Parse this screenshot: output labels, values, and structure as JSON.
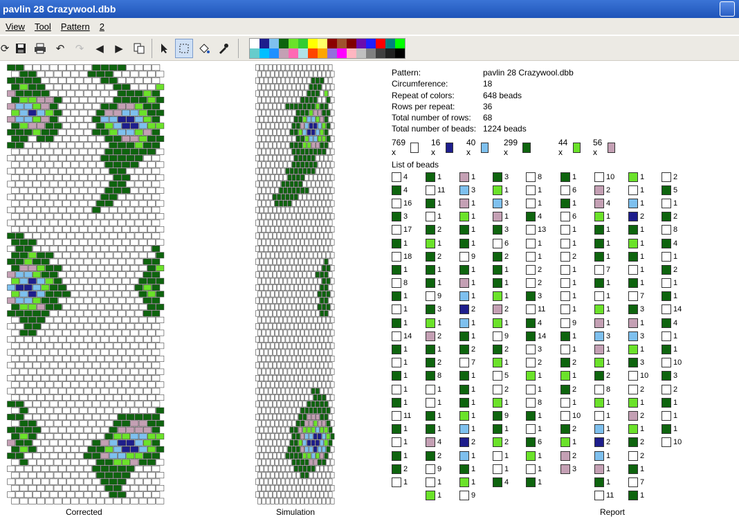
{
  "window": {
    "title": "pavlin 28 Crazywool.dbb"
  },
  "menu": [
    "View",
    "Tool",
    "Pattern",
    "2"
  ],
  "toolbar": [
    "refresh-icon",
    "save-icon",
    "print-icon",
    "undo-icon",
    "redo-icon",
    "arrow-left-icon",
    "arrow-right-icon",
    "copy-icon",
    "pointer-icon",
    "select-rect-icon",
    "fill-icon",
    "eyedropper-icon"
  ],
  "colors": {
    "white": "#ffffff",
    "dark_blue": "#1e1e8c",
    "light_blue": "#7ec0ee",
    "dark_green": "#0e640e",
    "lime": "#6be22a",
    "mauve": "#c4a0b4"
  },
  "palette": [
    "#ffffff",
    "#1e1e8c",
    "#7ec0ee",
    "#0e640e",
    "#6be22a",
    "#32cd32",
    "#ffff00",
    "#ffff66",
    "#8b0000",
    "#a0522d",
    "#800000",
    "#6a0dad",
    "#1e1eff",
    "#ff0000",
    "#008080",
    "#00ff00",
    "#66cccc",
    "#00bfff",
    "#1e90ff",
    "#c4a0b4",
    "#ff69b4",
    "#b0e0e6",
    "#ff4500",
    "#ffa500",
    "#9370db",
    "#ff00ff",
    "#ffb6c1",
    "#c0c0c0",
    "#808080",
    "#404040",
    "#202020",
    "#000000"
  ],
  "captions": {
    "corrected": "Corrected",
    "simulation": "Simulation",
    "report": "Report"
  },
  "info": [
    {
      "label": "Pattern:",
      "value": "pavlin 28 Crazywool.dbb"
    },
    {
      "label": "Circumference:",
      "value": "18"
    },
    {
      "label": "Repeat of colors:",
      "value": "648 beads"
    },
    {
      "label": "Rows per repeat:",
      "value": "36"
    },
    {
      "label": "Total number of rows:",
      "value": "68"
    },
    {
      "label": "Total number of beads:",
      "value": "1224 beads"
    }
  ],
  "totals": [
    {
      "count": "769 x",
      "color": "white"
    },
    {
      "count": "16 x",
      "color": "dark_blue"
    },
    {
      "count": "40 x",
      "color": "light_blue"
    },
    {
      "count": "299 x",
      "color": "dark_green"
    },
    {
      "count": "44 x",
      "color": "lime"
    },
    {
      "count": "56 x",
      "color": "mauve"
    }
  ],
  "list_label": "List of beads",
  "bead_list": [
    [
      [
        "W",
        "4"
      ],
      [
        "G",
        "4"
      ],
      [
        "W",
        "16"
      ],
      [
        "G",
        "3"
      ],
      [
        "W",
        "17"
      ],
      [
        "G",
        "1"
      ],
      [
        "W",
        "18"
      ],
      [
        "G",
        "1"
      ],
      [
        "W",
        "8"
      ],
      [
        "G",
        "1"
      ],
      [
        "W",
        "1"
      ],
      [
        "G",
        "1"
      ],
      [
        "W",
        "14"
      ],
      [
        "G",
        "1"
      ],
      [
        "W",
        "1"
      ],
      [
        "G",
        "1"
      ],
      [
        "W",
        "1"
      ],
      [
        "G",
        "1"
      ],
      [
        "W",
        "11"
      ],
      [
        "G",
        "1"
      ],
      [
        "W",
        "1"
      ],
      [
        "G",
        "1"
      ],
      [
        "G",
        "2"
      ],
      [
        "W",
        "1"
      ]
    ],
    [
      [
        "G",
        "1"
      ],
      [
        "W",
        "11"
      ],
      [
        "G",
        "1"
      ],
      [
        "W",
        "1"
      ],
      [
        "G",
        "2"
      ],
      [
        "L",
        "1"
      ],
      [
        "G",
        "2"
      ],
      [
        "G",
        "1"
      ],
      [
        "G",
        "1"
      ],
      [
        "W",
        "9"
      ],
      [
        "G",
        "3"
      ],
      [
        "L",
        "1"
      ],
      [
        "M",
        "2"
      ],
      [
        "G",
        "1"
      ],
      [
        "G",
        "2"
      ],
      [
        "G",
        "8"
      ],
      [
        "W",
        "1"
      ],
      [
        "W",
        "1"
      ],
      [
        "G",
        "1"
      ],
      [
        "G",
        "1"
      ],
      [
        "M",
        "4"
      ],
      [
        "G",
        "2"
      ],
      [
        "W",
        "9"
      ],
      [
        "W",
        "1"
      ],
      [
        "L",
        "1"
      ]
    ],
    [
      [
        "M",
        "1"
      ],
      [
        "B",
        "3"
      ],
      [
        "M",
        "1"
      ],
      [
        "L",
        "1"
      ],
      [
        "G",
        "1"
      ],
      [
        "G",
        "1"
      ],
      [
        "W",
        "9"
      ],
      [
        "G",
        "1"
      ],
      [
        "M",
        "1"
      ],
      [
        "B",
        "1"
      ],
      [
        "D",
        "2"
      ],
      [
        "B",
        "1"
      ],
      [
        "G",
        "1"
      ],
      [
        "G",
        "2"
      ],
      [
        "W",
        "7"
      ],
      [
        "G",
        "1"
      ],
      [
        "G",
        "1"
      ],
      [
        "G",
        "1"
      ],
      [
        "L",
        "1"
      ],
      [
        "B",
        "1"
      ],
      [
        "D",
        "2"
      ],
      [
        "B",
        "1"
      ],
      [
        "G",
        "1"
      ],
      [
        "L",
        "1"
      ],
      [
        "W",
        "9"
      ]
    ],
    [
      [
        "G",
        "3"
      ],
      [
        "L",
        "1"
      ],
      [
        "B",
        "3"
      ],
      [
        "M",
        "1"
      ],
      [
        "G",
        "3"
      ],
      [
        "W",
        "6"
      ],
      [
        "G",
        "2"
      ],
      [
        "G",
        "1"
      ],
      [
        "G",
        "1"
      ],
      [
        "L",
        "1"
      ],
      [
        "M",
        "2"
      ],
      [
        "L",
        "1"
      ],
      [
        "W",
        "9"
      ],
      [
        "G",
        "2"
      ],
      [
        "L",
        "1"
      ],
      [
        "W",
        "5"
      ],
      [
        "W",
        "2"
      ],
      [
        "L",
        "1"
      ],
      [
        "G",
        "9"
      ],
      [
        "G",
        "1"
      ],
      [
        "L",
        "2"
      ],
      [
        "W",
        "1"
      ],
      [
        "W",
        "1"
      ],
      [
        "G",
        "4"
      ]
    ],
    [
      [
        "W",
        "8"
      ],
      [
        "W",
        "1"
      ],
      [
        "W",
        "1"
      ],
      [
        "G",
        "4"
      ],
      [
        "W",
        "13"
      ],
      [
        "W",
        "1"
      ],
      [
        "W",
        "1"
      ],
      [
        "W",
        "2"
      ],
      [
        "W",
        "2"
      ],
      [
        "G",
        "3"
      ],
      [
        "W",
        "11"
      ],
      [
        "G",
        "4"
      ],
      [
        "G",
        "14"
      ],
      [
        "W",
        "3"
      ],
      [
        "W",
        "2"
      ],
      [
        "L",
        "1"
      ],
      [
        "W",
        "1"
      ],
      [
        "W",
        "8"
      ],
      [
        "G",
        "1"
      ],
      [
        "W",
        "1"
      ],
      [
        "G",
        "6"
      ],
      [
        "L",
        "1"
      ],
      [
        "W",
        "1"
      ],
      [
        "G",
        "1"
      ]
    ],
    [
      [
        "G",
        "1"
      ],
      [
        "W",
        "6"
      ],
      [
        "G",
        "1"
      ],
      [
        "W",
        "6"
      ],
      [
        "W",
        "1"
      ],
      [
        "W",
        "1"
      ],
      [
        "W",
        "2"
      ],
      [
        "W",
        "1"
      ],
      [
        "W",
        "1"
      ],
      [
        "W",
        "1"
      ],
      [
        "W",
        "1"
      ],
      [
        "W",
        "9"
      ],
      [
        "G",
        "1"
      ],
      [
        "W",
        "1"
      ],
      [
        "G",
        "2"
      ],
      [
        "L",
        "1"
      ],
      [
        "G",
        "2"
      ],
      [
        "W",
        "1"
      ],
      [
        "W",
        "10"
      ],
      [
        "G",
        "2"
      ],
      [
        "L",
        "1"
      ],
      [
        "M",
        "2"
      ],
      [
        "M",
        "3"
      ]
    ],
    [
      [
        "W",
        "10"
      ],
      [
        "M",
        "2"
      ],
      [
        "M",
        "4"
      ],
      [
        "L",
        "1"
      ],
      [
        "G",
        "1"
      ],
      [
        "G",
        "1"
      ],
      [
        "G",
        "1"
      ],
      [
        "W",
        "7"
      ],
      [
        "G",
        "1"
      ],
      [
        "W",
        "1"
      ],
      [
        "L",
        "1"
      ],
      [
        "M",
        "1"
      ],
      [
        "B",
        "3"
      ],
      [
        "M",
        "1"
      ],
      [
        "L",
        "1"
      ],
      [
        "G",
        "2"
      ],
      [
        "W",
        "8"
      ],
      [
        "L",
        "1"
      ],
      [
        "W",
        "1"
      ],
      [
        "B",
        "1"
      ],
      [
        "D",
        "2"
      ],
      [
        "B",
        "1"
      ],
      [
        "M",
        "1"
      ],
      [
        "G",
        "1"
      ],
      [
        "W",
        "11"
      ]
    ],
    [
      [
        "L",
        "1"
      ],
      [
        "W",
        "1"
      ],
      [
        "B",
        "1"
      ],
      [
        "D",
        "2"
      ],
      [
        "G",
        "1"
      ],
      [
        "L",
        "1"
      ],
      [
        "G",
        "1"
      ],
      [
        "W",
        "1"
      ],
      [
        "G",
        "1"
      ],
      [
        "W",
        "7"
      ],
      [
        "G",
        "3"
      ],
      [
        "M",
        "1"
      ],
      [
        "B",
        "3"
      ],
      [
        "L",
        "1"
      ],
      [
        "G",
        "3"
      ],
      [
        "W",
        "10"
      ],
      [
        "W",
        "2"
      ],
      [
        "L",
        "1"
      ],
      [
        "M",
        "2"
      ],
      [
        "L",
        "1"
      ],
      [
        "G",
        "2"
      ],
      [
        "W",
        "2"
      ],
      [
        "G",
        "1"
      ],
      [
        "W",
        "7"
      ],
      [
        "G",
        "1"
      ]
    ],
    [
      [
        "W",
        "2"
      ],
      [
        "G",
        "5"
      ],
      [
        "W",
        "1"
      ],
      [
        "G",
        "2"
      ],
      [
        "W",
        "8"
      ],
      [
        "G",
        "4"
      ],
      [
        "W",
        "1"
      ],
      [
        "G",
        "2"
      ],
      [
        "W",
        "1"
      ],
      [
        "G",
        "1"
      ],
      [
        "W",
        "14"
      ],
      [
        "G",
        "4"
      ],
      [
        "W",
        "1"
      ],
      [
        "G",
        "1"
      ],
      [
        "W",
        "10"
      ],
      [
        "G",
        "3"
      ],
      [
        "W",
        "2"
      ],
      [
        "G",
        "1"
      ],
      [
        "W",
        "1"
      ],
      [
        "G",
        "1"
      ],
      [
        "W",
        "10"
      ]
    ]
  ],
  "patterns": {
    "corrected": [
      "GGWWWWWWWWGGGGWWWW",
      "WGGWWWWWWGGGWWWWWW",
      "GGGGWWWWWWWGGWWWWW",
      "GLGGWWWWWWWWGGWWWL",
      "MGGGGWWWWWWWWGGGLG",
      "GLLMMGWWWWWWGGGGLG",
      "MBBLMGWWWWWGGMMLGG",
      "LBDBLGWWWWGMMBBLGG",
      "MBBLMGWWWWGBBDDBLG",
      "GLMMGGWWWWGLBDDBLL",
      "GGGLGGWWWWGGLBBLMG",
      "GGWGGWWWWWWGGMMLGG",
      "GGWWWWWWWWWWGGGLGG",
      "WWWWWWWWWWWGGGGGGW",
      "WWWWWWWWWWWGGGGGWW",
      "WWWWWWWWWWWGGGGWWW",
      "WWWWWWWWWWWWGGWWWW",
      "WWWWWWWWWWWWGGWWWW",
      "WWWWWWWWWWWWGGWWWW",
      "WWWWWWWWWWWGGGWWWW",
      "WWWWWWWWWWWGGWWWWW",
      "WWWWWWWWWWGGWWWWWW",
      "WWWWWWWWWWGWWWWWWW",
      "WWWWWWWWWWWWWWWWWW",
      "WWWWWWWWWWWWWWWWWW",
      "WWWWWWWWWWWWWWWWWW",
      "GGWWWWWWWWWWWWWWWW",
      "GGGWWWWWWWWWWWWWWW",
      "WGGWWWWWWWWWWWWWWG",
      "GGLGGWWWWWWWWWWWWG",
      "GGLGGWWWWWWWWWWWGG",
      "GMMLGGWWWWWWWWWWGL",
      "MBBLGGWWWWWWWWWWGG",
      "LBDBLGWWWWWWWWWGGG",
      "BDDBLGGWWWWWWWWGLG",
      "LBDBGGGWWWWWWWWGLG",
      "MBBLGGWWWWWWWWWWGG",
      "GLLMGGWWWWWWWWWWGG",
      "GGGGGWWWWWWWWWWWGG",
      "WGGGWWWWWWWWWWWWWW",
      "WWGGWWWWWWWWWWWWWW",
      "WGGWWWWWWWWWWWWWWW",
      "WWWWWWWWWWWWWWWWWW",
      "WWWWWWWWWWWWWWWWWW",
      "WWWWWWWWWWWWWWWWWW",
      "WWWWWWWWWWWWWWWWWW",
      "WWWWWWWWWWWWWWWWWW",
      "WWWWWWWWWWWWWWWWWW",
      "WWWWWWWWWWWWWWWWWW",
      "WWWWWWWWWWWWWWWWWW",
      "WWWWWWWWWWWWWWWWWW",
      "WWWWWWWWWWWWWWWWWW",
      "GGWWWWWWWWWWWWWWWW",
      "WGWWWWWWWWWWWWWWWG",
      "GGWWWWWWWWWWWGGGGG",
      "WGGWWWWWWWWWGGMMGG",
      "GGGGWWWWWWWWGMMMMG",
      "GLGWWWWWWWWGLLBBLL",
      "MGGWWWWWWWGMBDDBLG",
      "GLGWWWWWWGGLBDDBLG",
      "GGWWWWWWWGGMBBLLGG",
      "WGWWWWWWWWGGLLMGGW",
      "WWWWWWWWWWGGGGGWWW",
      "WWWWWWWWWWGGGGWWWW",
      "WWWWWWWWWWWGGGWWWW",
      "WWWWWWWWWWWGGWWWWW",
      "WWWWWWWWWWWWGGWWWW",
      "WWWWWWWWWWWWWWWWWW"
    ],
    "simulation": [
      "WWWWWWWWWWWWWWWWWW",
      "WWWWWWWWWWWWWWWWWW",
      "WWWWWWWWWWWWWGGGWW",
      "WWWWWWWWWWWWGGGWWW",
      "WWWWWWWWWWWWGGGWLW",
      "WWWWWWWWWWGGGGWWGW",
      "WWWWWWWGGGGGGGLGGW",
      "WWWWWWWWWGGGLMMGGW",
      "WWWWWWWWWGGLBBLMGW",
      "WWWWWWWWGGMBDDBLGW",
      "WWWWWWWWGGLBDDBLGW",
      "WWWWWWWWWGGLBBLLGW",
      "WWWWWWWWGGGLLMMGGW",
      "WWWWWWWWGGGGGGGGWW",
      "WWWWWWWWWGGGGGWWWW",
      "WWWWWWWWGGGGGGWWWW",
      "WWWWWWWGGGGGGGWWWW",
      "WWWWWWWGGGGWWWWWWW",
      "WWWWWWGGGGGWWWWWWW",
      "WWWWWGGGGGGGWWWWWW",
      "WWWWGGGGGGWWWWWWWW",
      "WWWWGGGGWWWWWWWWWW",
      "WWWWWWWWWWWWWWWWWW",
      "WWWWWWWWWWWWWWWWWW",
      "WWWWWWWWWWWWWWWWWW",
      "WWWWWWWWWWWWWWWWWW",
      "WWWWWWWWWWWWWWWWWW",
      "WWWWWWWWWWWWWWWWWW",
      "WWWWWWWWWWWWWWWWWW",
      "WWWWWWWWWWWWWWWWWW",
      "WWWWWWWWWWWWWWWWGW",
      "WWWWWWWWWWWWWWWGGW",
      "WWWWWWWWWWWWWWGGGW",
      "WWWWWWWWWWWWWWWGGW",
      "WWWWWWWWWWWWWWWGGW",
      "WWWWWWWWWWWWWWGGGW",
      "WWWWWWWWWWWWWWWGGW",
      "WWWWWWWWWWWWWWGGGW",
      "WWWWWWWWWWWWWWWGGW",
      "WWWWWWWWWWWWWWWWWW",
      "WWWWWWWWWWWWWWWWWW",
      "WWWWWWWWWWWWWWWWWW",
      "WWWWWWWWWWWWWWWWWW",
      "WWWWWWWWWWWWWWWWWW",
      "WWWWWWWWWWWWWWWWWW",
      "WWWWWWWWWWWWWWWWWW",
      "WWWWWWWWWWWWWWWWWW",
      "WWWWWWWWWWWWWWWWWW",
      "WWWWWWWWWWWWWWWWWW",
      "WWWWWWWWWWWWWWWWWW",
      "WWWWWWWWWWWWWGGWWW",
      "WWWWWWWWWWWWWGGGWW",
      "WWWWWWWWWWWWGGGGGW",
      "WWWWWWWWWWGGGGGGGW",
      "WWWWWWWWWWGGMMMGGW",
      "WWWWWWWWWGGMMLMMGW",
      "WWWWWWWWGGMLLLBLLG",
      "WWWWWWWWGGMBBDDBLG",
      "WWWWWWWWGGLBDDDBLG",
      "WWWWWWWGGGMBBDBBGW",
      "WWWWWWWGGGGLLBLMGW",
      "WWWWWWWWGGGGMMGGWW",
      "WWWWWWWWWGGGGGWWWW",
      "WWWWWWWWWWGGWWWWWW",
      "WWWWWWWWWWWWWWWWWW",
      "WWWWWWWWWWWWWWWWWW",
      "WWWWWWWWWWWWWWWWWW",
      "WWWWWWWWWWWWWWWWWW"
    ]
  }
}
